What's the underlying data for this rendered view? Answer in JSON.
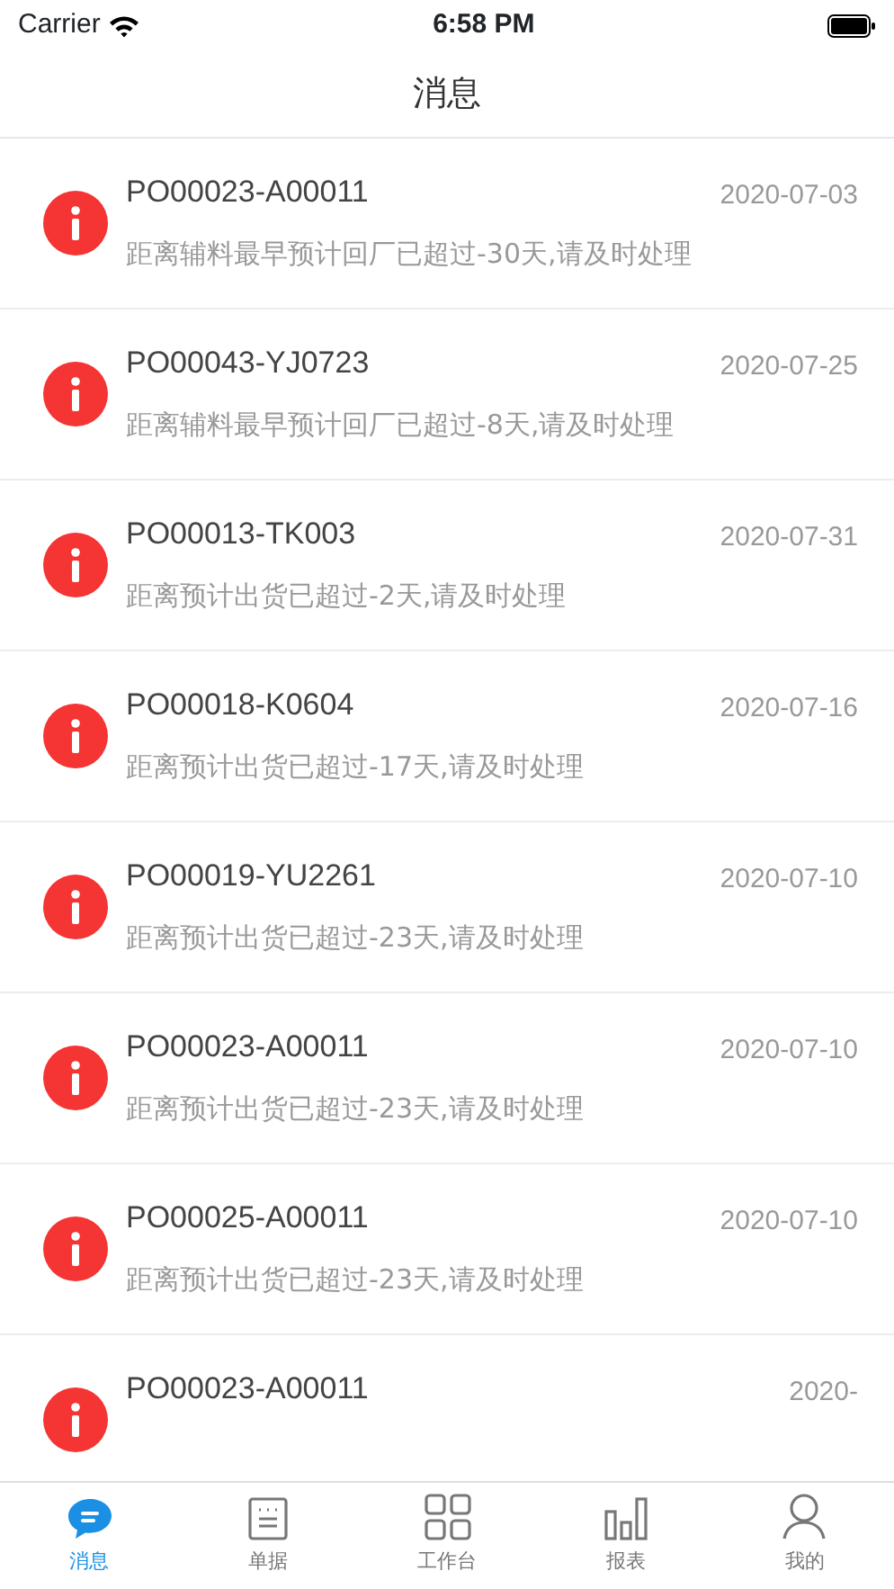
{
  "status_bar": {
    "carrier": "Carrier",
    "time": "6:58 PM"
  },
  "nav": {
    "title": "消息"
  },
  "messages": [
    {
      "title": "PO00023-A00011",
      "text": "距离辅料最早预计回厂已超过-30天,请及时处理",
      "date": "2020-07-03"
    },
    {
      "title": "PO00043-YJ0723",
      "text": "距离辅料最早预计回厂已超过-8天,请及时处理",
      "date": "2020-07-25"
    },
    {
      "title": "PO00013-TK003",
      "text": "距离预计出货已超过-2天,请及时处理",
      "date": "2020-07-31"
    },
    {
      "title": "PO00018-K0604",
      "text": "距离预计出货已超过-17天,请及时处理",
      "date": "2020-07-16"
    },
    {
      "title": "PO00019-YU2261",
      "text": "距离预计出货已超过-23天,请及时处理",
      "date": "2020-07-10"
    },
    {
      "title": "PO00023-A00011",
      "text": "距离预计出货已超过-23天,请及时处理",
      "date": "2020-07-10"
    },
    {
      "title": "PO00025-A00011",
      "text": "距离预计出货已超过-23天,请及时处理",
      "date": "2020-07-10"
    },
    {
      "title": "PO00023-A00011",
      "date": "2020-"
    }
  ],
  "tab_bar": [
    {
      "kind": "chat",
      "label": "消息",
      "selected": true
    },
    {
      "kind": "doc",
      "label": "单据",
      "selected": false
    },
    {
      "kind": "grid",
      "label": "工作台",
      "selected": false
    },
    {
      "kind": "bars",
      "label": "报表",
      "selected": false
    },
    {
      "kind": "person",
      "label": "我的",
      "selected": false
    }
  ]
}
